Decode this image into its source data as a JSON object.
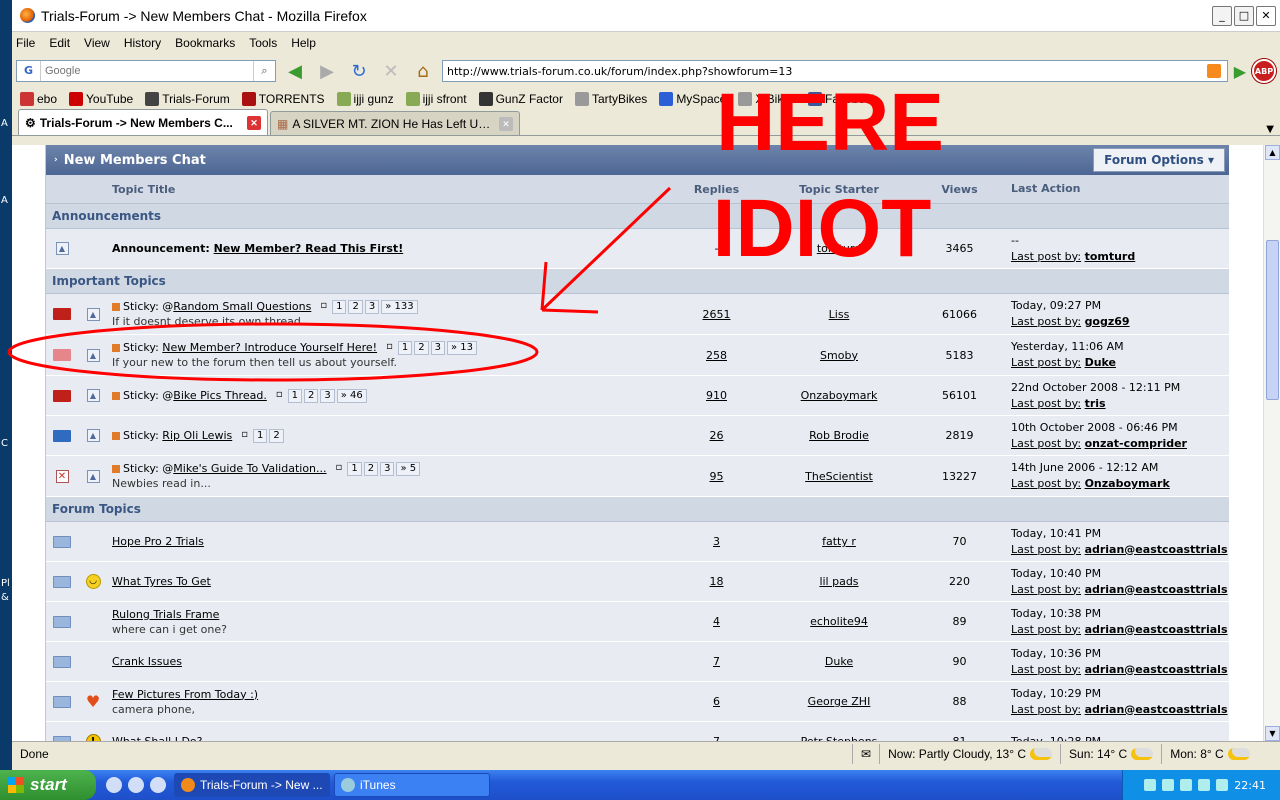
{
  "window": {
    "title": "Trials-Forum -> New Members Chat - Mozilla Firefox"
  },
  "menu": [
    "File",
    "Edit",
    "View",
    "History",
    "Bookmarks",
    "Tools",
    "Help"
  ],
  "search": {
    "placeholder": "Google"
  },
  "url": "http://www.trials-forum.co.uk/forum/index.php?showforum=13",
  "bookmarks": [
    "ebo",
    "YouTube",
    "Trials-Forum",
    "TORRENTS",
    "ijji gunz",
    "ijji sfront",
    "GunZ Factor",
    "TartyBikes",
    "MySpace",
    "X Bikes",
    "Facebook"
  ],
  "tabs": [
    {
      "label": "Trials-Forum -> New Members C...",
      "active": true
    },
    {
      "label": "A SILVER MT. ZION He Has Left Us Al...",
      "active": false
    }
  ],
  "forum": {
    "title": "New Members Chat",
    "options_label": "Forum Options ▾",
    "columns": {
      "title": "Topic Title",
      "replies": "Replies",
      "starter": "Topic Starter",
      "views": "Views",
      "last": "Last Action"
    },
    "sections": {
      "announcements": "Announcements",
      "important": "Important Topics",
      "forum": "Forum Topics"
    },
    "announcement": {
      "prefix": "Announcement:",
      "title": "New Member? Read This First!",
      "replies": "-",
      "starter": "tomturd",
      "views": "3465",
      "last_time": "--",
      "last_by_label": "Last post by:",
      "last_by": "tomturd"
    },
    "important": [
      {
        "icon": "red",
        "prefix": "Sticky: @",
        "title": "Random Small Questions",
        "pages": [
          "1",
          "2",
          "3",
          "» 133"
        ],
        "desc": "If it doesnt deserve its own thread...",
        "replies": "2651",
        "starter": "Liss",
        "views": "61066",
        "last_time": "Today, 09:27 PM",
        "last_by": "gogz69"
      },
      {
        "icon": "pink",
        "prefix": "Sticky: ",
        "title": "New Member? Introduce Yourself Here!",
        "pages": [
          "1",
          "2",
          "3",
          "» 13"
        ],
        "desc": "If your new to the forum then tell us about yourself.",
        "replies": "258",
        "starter": "Smoby",
        "views": "5183",
        "last_time": "Yesterday, 11:06 AM",
        "last_by": "Duke"
      },
      {
        "icon": "red",
        "prefix": "Sticky: @",
        "title": "Bike Pics Thread.",
        "pages": [
          "1",
          "2",
          "3",
          "» 46"
        ],
        "desc": "",
        "replies": "910",
        "starter": "Onzaboymark",
        "views": "56101",
        "last_time": "22nd October 2008 - 12:11 PM",
        "last_by": "tris"
      },
      {
        "icon": "blue",
        "prefix": "Sticky: ",
        "title": "Rip Oli Lewis",
        "pages": [
          "1",
          "2"
        ],
        "desc": "",
        "replies": "26",
        "starter": "Rob Brodie",
        "views": "2819",
        "last_time": "10th October 2008 - 06:46 PM",
        "last_by": "onzat-comprider"
      },
      {
        "icon": "x",
        "prefix": "Sticky: @",
        "title": "Mike's Guide To Validation...",
        "pages": [
          "1",
          "2",
          "3",
          "» 5"
        ],
        "desc": "Newbies read in...",
        "replies": "95",
        "starter": "TheScientist",
        "views": "13227",
        "last_time": "14th June 2006 - 12:12 AM",
        "last_by": "Onzaboymark"
      }
    ],
    "topics": [
      {
        "emo": "",
        "title": "Hope Pro 2 Trials",
        "desc": "",
        "replies": "3",
        "starter": "fatty r",
        "views": "70",
        "last_time": "Today, 10:41 PM",
        "last_by": "adrian@eastcoasttrials"
      },
      {
        "emo": "smile",
        "title": "What Tyres To Get",
        "desc": "",
        "replies": "18",
        "starter": "lil pads",
        "views": "220",
        "last_time": "Today, 10:40 PM",
        "last_by": "adrian@eastcoasttrials"
      },
      {
        "emo": "",
        "title": "Rulong Trials Frame",
        "desc": "where can i get one?",
        "replies": "4",
        "starter": "echolite94",
        "views": "89",
        "last_time": "Today, 10:38 PM",
        "last_by": "adrian@eastcoasttrials"
      },
      {
        "emo": "",
        "title": "Crank Issues",
        "desc": "",
        "replies": "7",
        "starter": "Duke",
        "views": "90",
        "last_time": "Today, 10:36 PM",
        "last_by": "adrian@eastcoasttrials"
      },
      {
        "emo": "heart",
        "title": "Few Pictures From Today :)",
        "desc": "camera phone,",
        "replies": "6",
        "starter": "George ZHI",
        "views": "88",
        "last_time": "Today, 10:29 PM",
        "last_by": "adrian@eastcoasttrials"
      },
      {
        "emo": "warn",
        "title": "What Shall I Do?",
        "desc": "",
        "replies": "7",
        "starter": "Petr Stephens",
        "views": "81",
        "last_time": "Today, 10:28 PM",
        "last_by": ""
      }
    ]
  },
  "annotation": {
    "line1": "HERE",
    "line2": "IDIOT",
    "color": "#ff0000"
  },
  "status": {
    "text": "Done",
    "weather_now": "Now: Partly Cloudy, 13° C",
    "weather_sun": "Sun: 14° C",
    "weather_mon": "Mon: 8° C"
  },
  "taskbar": {
    "start": "start",
    "items": [
      {
        "label": "Trials-Forum -> New ...",
        "active": true
      },
      {
        "label": "iTunes",
        "active": false
      }
    ],
    "clock": "22:41"
  },
  "desktop_fragments": [
    "A",
    "A",
    "C",
    "Pl",
    "&"
  ]
}
